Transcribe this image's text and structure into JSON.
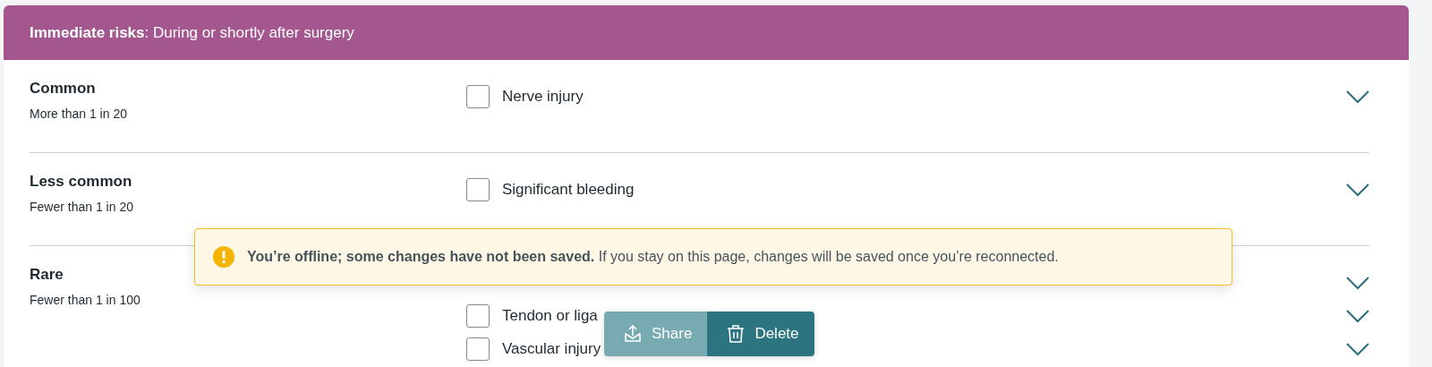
{
  "header": {
    "title": "**Immediate risks**: During or shortly after surgery"
  },
  "categories": [
    {
      "name": "Common",
      "frequency": "More than 1 in 20",
      "items": [
        {
          "kind": "risk",
          "label": "Nerve injury",
          "checked": false
        }
      ]
    },
    {
      "name": "Less common",
      "frequency": "Fewer than 1 in 20",
      "items": [
        {
          "kind": "risk",
          "label": "Significant bleeding",
          "checked": false
        }
      ]
    },
    {
      "name": "Rare",
      "frequency": "Fewer than 1 in 100",
      "items": [
        {
          "kind": "covered"
        },
        {
          "kind": "risk",
          "label": "Tendon or liga",
          "checked": false
        },
        {
          "kind": "risk",
          "label": "Vascular injury",
          "checked": false
        }
      ]
    }
  ],
  "toast": {
    "message": "**You’re offline; some changes have not been saved.** If you stay on this page, changes will be saved once you’re reconnected."
  },
  "actions": [
    {
      "kind": "share",
      "label": "Share",
      "disabled": true
    },
    {
      "kind": "delete",
      "label": "Delete",
      "disabled": false
    }
  ]
}
